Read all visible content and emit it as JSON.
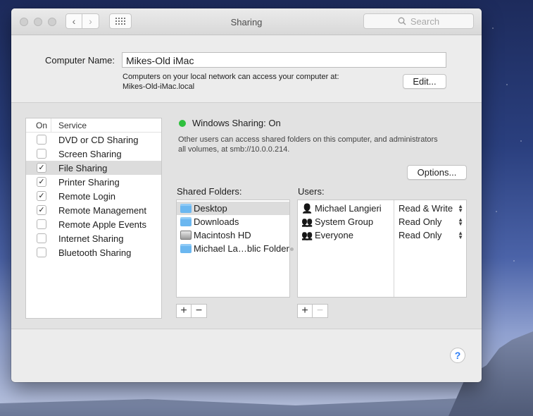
{
  "window": {
    "title": "Sharing"
  },
  "toolbar": {
    "back_label": "‹",
    "forward_label": "›",
    "search_placeholder": "Search"
  },
  "computer": {
    "name_label": "Computer Name:",
    "name_value": "Mikes-Old iMac",
    "info_line1": "Computers on your local network can access your computer at:",
    "info_line2": "Mikes-Old-iMac.local",
    "edit_label": "Edit..."
  },
  "services": {
    "col_on": "On",
    "col_service": "Service",
    "items": [
      {
        "label": "DVD or CD Sharing",
        "checked": false
      },
      {
        "label": "Screen Sharing",
        "checked": false
      },
      {
        "label": "File Sharing",
        "checked": true
      },
      {
        "label": "Printer Sharing",
        "checked": true
      },
      {
        "label": "Remote Login",
        "checked": true
      },
      {
        "label": "Remote Management",
        "checked": true
      },
      {
        "label": "Remote Apple Events",
        "checked": false
      },
      {
        "label": "Internet Sharing",
        "checked": false
      },
      {
        "label": "Bluetooth Sharing",
        "checked": false
      }
    ]
  },
  "status": {
    "title": "Windows Sharing: On",
    "color": "#2fc03e",
    "desc_line1": "Other users can access shared folders on this computer, and administrators",
    "desc_line2": "all volumes, at smb://10.0.0.214.",
    "options_label": "Options..."
  },
  "folders": {
    "label": "Shared Folders:",
    "items": [
      "Desktop",
      "Downloads",
      "Macintosh HD",
      "Michael La…blic Folder"
    ]
  },
  "users": {
    "label": "Users:",
    "items": [
      {
        "name": "Michael Langieri",
        "perm": "Read & Write"
      },
      {
        "name": "System Group",
        "perm": "Read Only"
      },
      {
        "name": "Everyone",
        "perm": "Read Only"
      }
    ]
  },
  "buttons": {
    "add": "+",
    "remove": "−",
    "help": "?"
  },
  "colors": {
    "folder_blue": "#6bb7f0",
    "check": "#222222"
  }
}
